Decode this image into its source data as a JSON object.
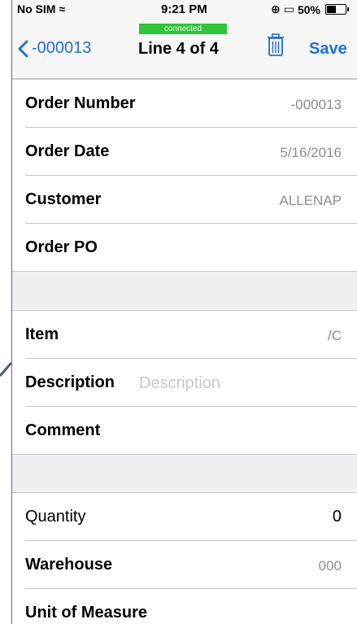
{
  "status_bar": {
    "carrier": "No SIM",
    "time": "9:21 PM",
    "battery": "50%"
  },
  "connection_status": "connected",
  "nav": {
    "back_label": "-000013",
    "title": "Line 4 of 4",
    "save_label": "Save"
  },
  "order": {
    "order_number_label": "Order Number",
    "order_number_value": "-000013",
    "order_date_label": "Order Date",
    "order_date_value": "5/16/2016",
    "customer_label": "Customer",
    "customer_value": "ALLENAP",
    "order_po_label": "Order PO"
  },
  "line": {
    "item_label": "Item",
    "item_value": "/C",
    "description_label": "Description",
    "description_placeholder": "Description",
    "comment_label": "Comment"
  },
  "details": {
    "quantity_label": "Quantity",
    "quantity_value": "0",
    "warehouse_label": "Warehouse",
    "warehouse_value": "000",
    "uom_label": "Unit of Measure"
  },
  "colors": {
    "accent": "#1f6fd6",
    "connected": "#2ec43b"
  }
}
